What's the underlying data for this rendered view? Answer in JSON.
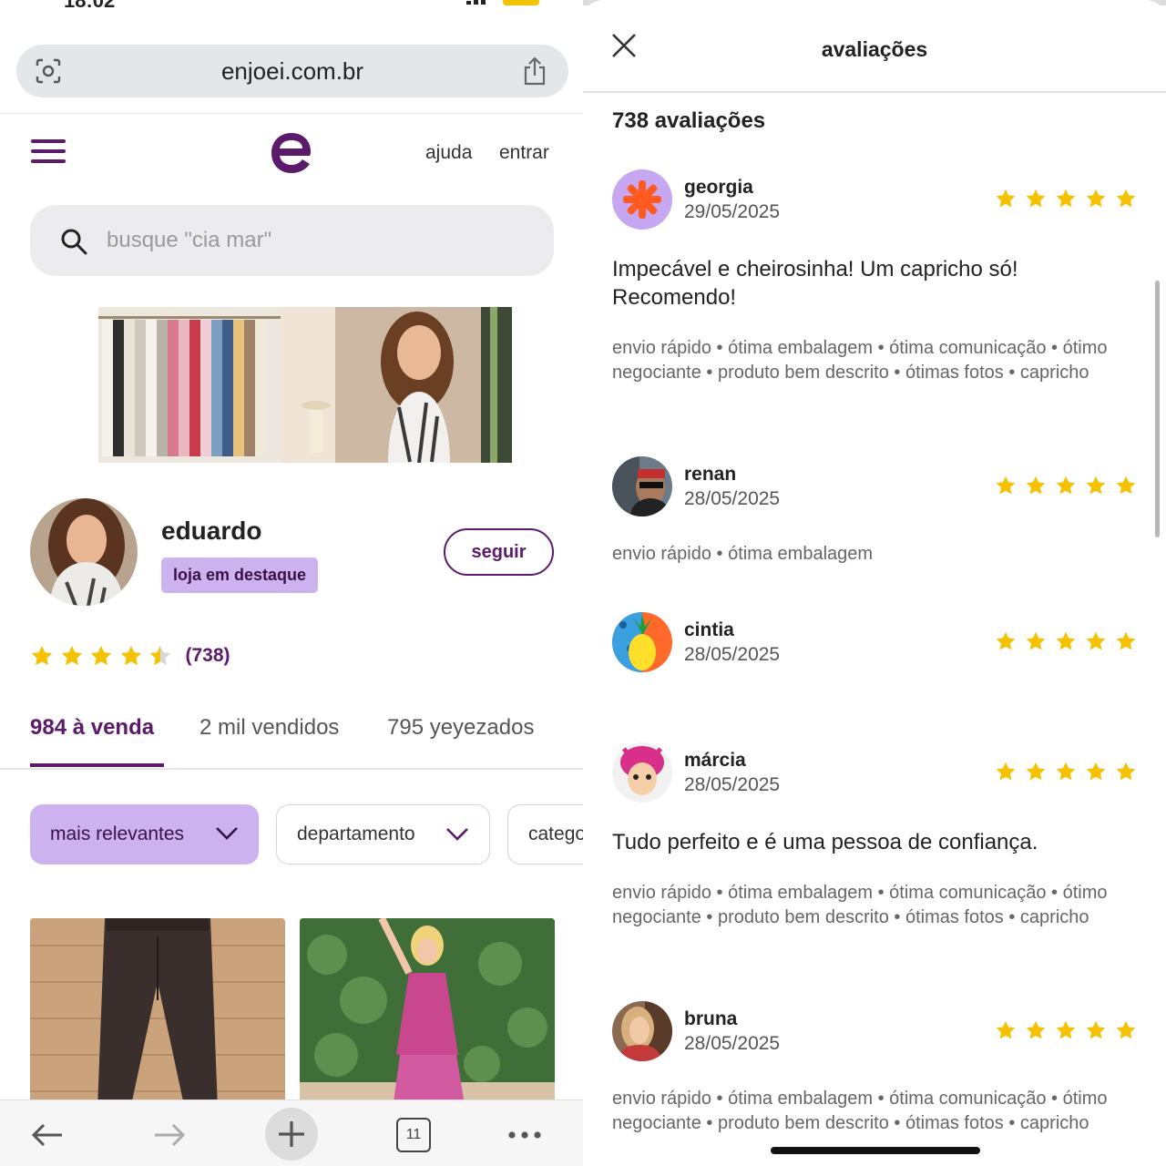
{
  "status": {
    "time": "18:02"
  },
  "browser": {
    "url": "enjoei.com.br",
    "tabs_count": "11"
  },
  "site": {
    "nav_help": "ajuda",
    "nav_login": "entrar",
    "search_placeholder": "busque \"cia mar\""
  },
  "store": {
    "name": "eduardo",
    "badge": "loja em destaque",
    "follow_label": "seguir",
    "rating": 4.5,
    "rating_count": "(738)"
  },
  "tabs": [
    {
      "label": "984 à venda",
      "active": true
    },
    {
      "label": "2 mil vendidos",
      "active": false
    },
    {
      "label": "795 yeyezados",
      "active": false
    }
  ],
  "filters": [
    {
      "label": "mais relevantes"
    },
    {
      "label": "departamento"
    },
    {
      "label": "catego"
    }
  ],
  "colors": {
    "brand": "#5c1a6b",
    "badge": "#cdb2f0",
    "star": "#f5c100"
  },
  "reviews_modal": {
    "title": "avaliações",
    "count_label": "738 avaliações",
    "reviews": [
      {
        "name": "georgia",
        "date": "29/05/2025",
        "stars": 5,
        "comment": "Impecável e cheirosinha! Um capricho só! Recomendo!",
        "tags": "envio rápido • ótima embalagem • ótima comunicação • ótimo negociante • produto bem descrito • ótimas fotos • capricho"
      },
      {
        "name": "renan",
        "date": "28/05/2025",
        "stars": 5,
        "comment": "",
        "tags": "envio rápido • ótima embalagem"
      },
      {
        "name": "cintia",
        "date": "28/05/2025",
        "stars": 5,
        "comment": "",
        "tags": ""
      },
      {
        "name": "márcia",
        "date": "28/05/2025",
        "stars": 5,
        "comment": "Tudo perfeito e é uma pessoa de confiança.",
        "tags": "envio rápido • ótima embalagem • ótima comunicação • ótimo negociante • produto bem descrito • ótimas fotos • capricho"
      },
      {
        "name": "bruna",
        "date": "28/05/2025",
        "stars": 5,
        "comment": "",
        "tags": "envio rápido • ótima embalagem • ótima comunicação • ótimo negociante • produto bem descrito • ótimas fotos • capricho"
      }
    ]
  }
}
